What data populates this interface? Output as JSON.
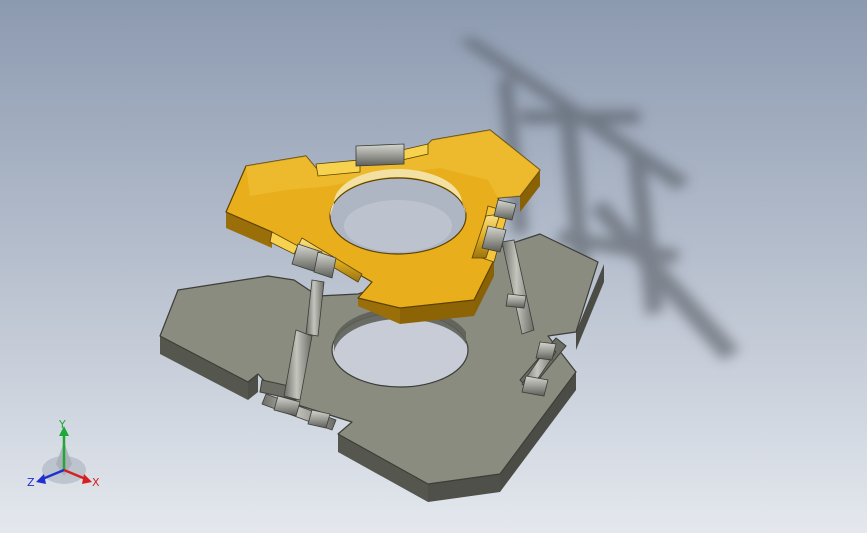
{
  "viewport": {
    "background_top": "#8c9ab0",
    "background_bottom": "#e4e8ee"
  },
  "model": {
    "top_plate_color": "#e8ae1c",
    "base_plate_color": "#8a8c80",
    "strut_color": "#9a9b94"
  },
  "triad": {
    "x_label": "X",
    "y_label": "Y",
    "z_label": "Z",
    "x_color": "#d62020",
    "y_color": "#1fa83a",
    "z_color": "#2030d0"
  }
}
